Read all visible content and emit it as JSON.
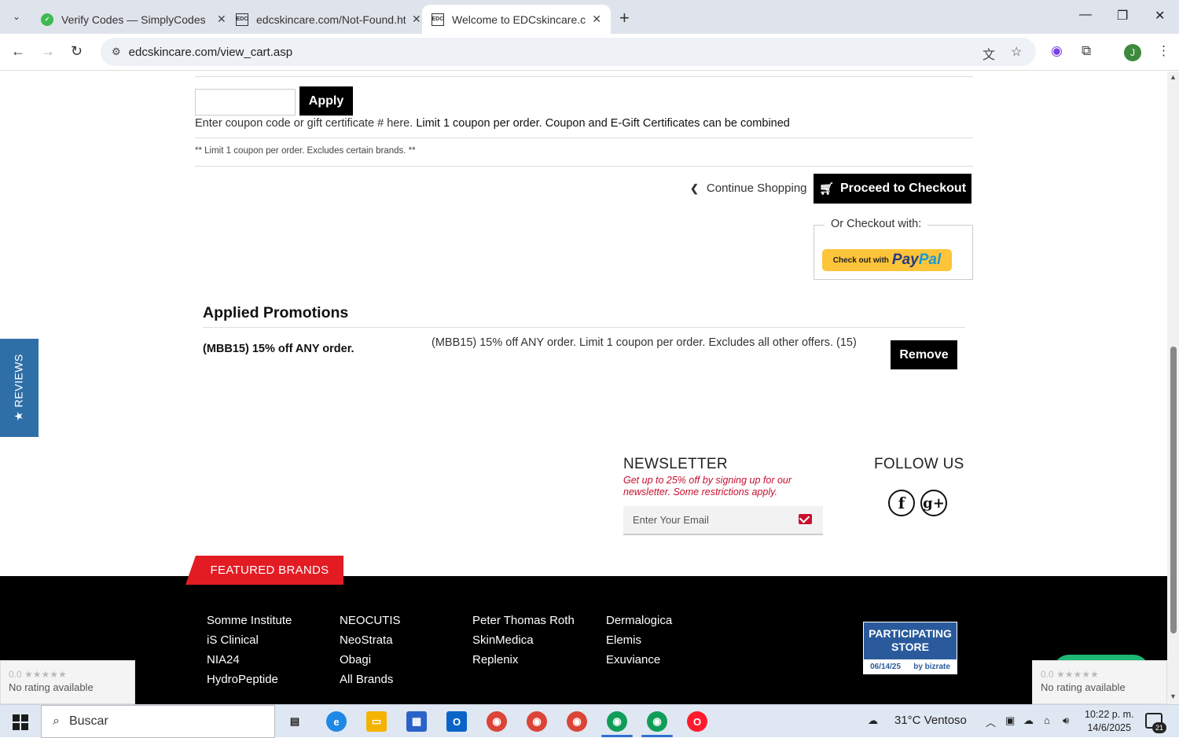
{
  "browser": {
    "tabs": [
      {
        "title": "Verify Codes — SimplyCodes"
      },
      {
        "title": "edcskincare.com/Not-Found.ht"
      },
      {
        "title": "Welcome to EDCskincare.com -"
      }
    ],
    "url": "edcskincare.com/view_cart.asp",
    "profile_initial": "J"
  },
  "coupon": {
    "apply_label": "Apply",
    "help_prefix": "Enter coupon code or gift certificate # here.",
    "help_bold": "Limit 1 coupon per order. Coupon and E-Gift Certificates can be combined",
    "limit_note": "** Limit 1 coupon per order. Excludes certain brands. **"
  },
  "checkout": {
    "continue_label": "Continue Shopping",
    "proceed_label": "Proceed to Checkout",
    "alt_label": "Or Checkout with:",
    "paypal_prefix": "Check out with",
    "paypal_brand_1": "Pay",
    "paypal_brand_2": "Pal"
  },
  "promotions": {
    "title": "Applied Promotions",
    "items": [
      {
        "name": "(MBB15) 15% off ANY order.",
        "description": "(MBB15) 15% off ANY order. Limit 1 coupon per order. Excludes all other offers. (15)",
        "remove_label": "Remove"
      }
    ]
  },
  "reviews_tab": "★ REVIEWS",
  "newsletter": {
    "title": "NEWSLETTER",
    "subtitle": "Get up to 25% off by signing up for our newsletter. Some restrictions apply.",
    "placeholder": "Enter Your Email"
  },
  "follow": {
    "title": "FOLLOW US",
    "facebook_glyph": "f",
    "gplus_glyph": "g+"
  },
  "featured_brands": {
    "tab_label": "FEATURED BRANDS",
    "columns": [
      [
        "Somme Institute",
        "iS Clinical",
        "NIA24",
        "HydroPeptide"
      ],
      [
        "NEOCUTIS",
        "NeoStrata",
        "Obagi",
        "All Brands"
      ],
      [
        "Peter Thomas Roth",
        "SkinMedica",
        "Replenix"
      ],
      [
        "Dermalogica",
        "Elemis",
        "Exuviance"
      ]
    ]
  },
  "bizrate": {
    "line1": "PARTICIPATING",
    "line2": "STORE",
    "date": "06/14/25",
    "by": "by bizrate"
  },
  "rating_widget": {
    "score": "0.0",
    "stars": "★★★★★",
    "label": "No rating available"
  },
  "taskbar": {
    "search_placeholder": "Buscar",
    "weather": "31°C  Ventoso",
    "time": "10:22 p. m.",
    "date": "14/6/2025",
    "notifications": "21"
  }
}
